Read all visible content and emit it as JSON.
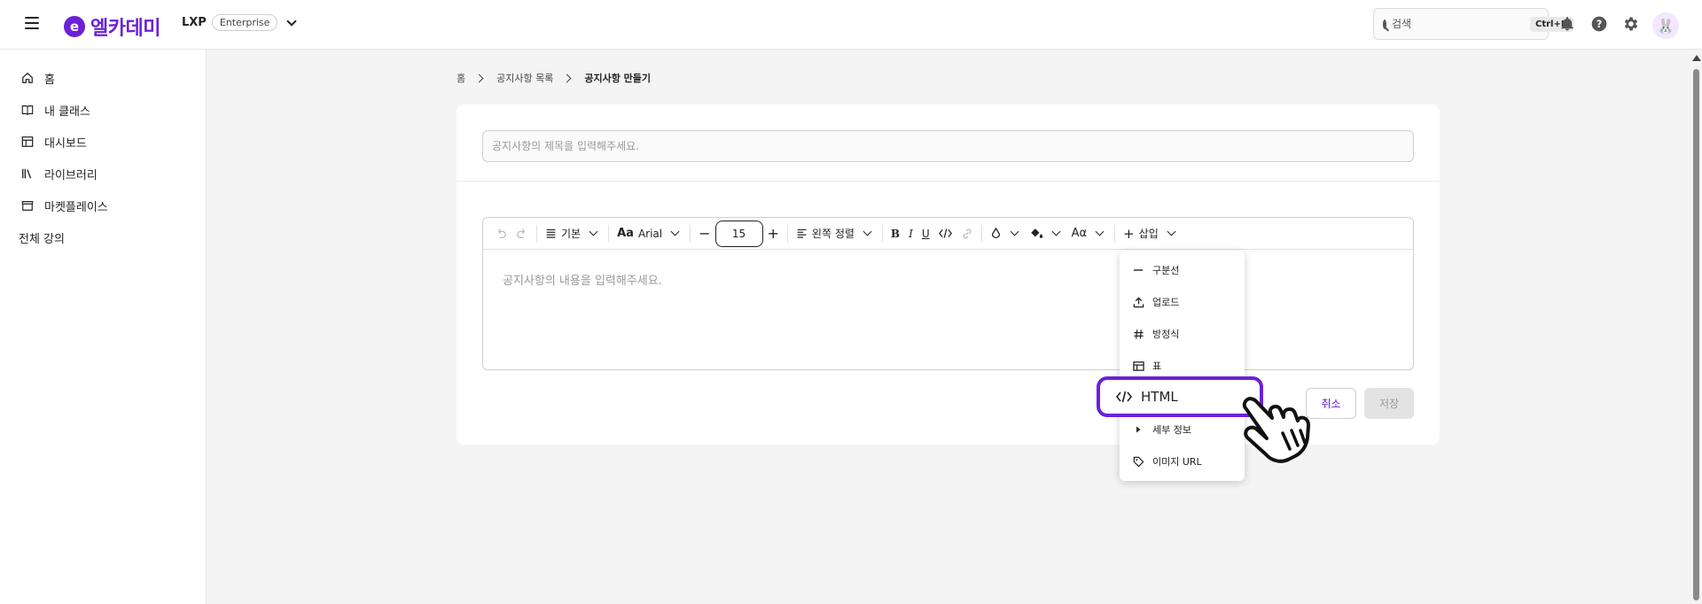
{
  "header": {
    "logo_mark": "e",
    "logo_text": "엘카데미",
    "product_name": "LXP",
    "product_badge": "Enterprise",
    "search_placeholder": "검색",
    "search_shortcut": "Ctrl+K",
    "avatar_glyph": "🐰"
  },
  "sidebar": {
    "items": [
      {
        "label": "홈",
        "icon": "home-icon"
      },
      {
        "label": "내 클래스",
        "icon": "book-icon"
      },
      {
        "label": "대시보드",
        "icon": "table-icon"
      },
      {
        "label": "라이브러리",
        "icon": "library-icon"
      },
      {
        "label": "마켓플레이스",
        "icon": "store-icon"
      }
    ],
    "section_label": "전체 강의"
  },
  "breadcrumb": {
    "home": "홈",
    "list": "공지사항 목록",
    "current": "공지사항 만들기"
  },
  "form": {
    "title_placeholder": "공지사항의 제목을 입력해주세요.",
    "body_placeholder": "공지사항의 내용을 입력해주세요.",
    "cancel_label": "취소",
    "save_label": "저장"
  },
  "toolbar": {
    "block_type": "기본",
    "font_family": "Arial",
    "font_size": "15",
    "align": "왼쪽 정렬",
    "insert": "삽입"
  },
  "insert_menu": {
    "items": [
      {
        "label": "구분선",
        "icon": "horizontal-rule-icon"
      },
      {
        "label": "업로드",
        "icon": "upload-icon"
      },
      {
        "label": "방정식",
        "icon": "equation-icon"
      },
      {
        "label": "표",
        "icon": "table-icon"
      },
      {
        "label": "HTML",
        "icon": "code-icon"
      },
      {
        "label": "세부 정보",
        "icon": "caret-right-icon"
      },
      {
        "label": "이미지 URL",
        "icon": "tag-icon"
      }
    ]
  },
  "colors": {
    "brand": "#6b21d8",
    "background": "#f4f4f5"
  }
}
